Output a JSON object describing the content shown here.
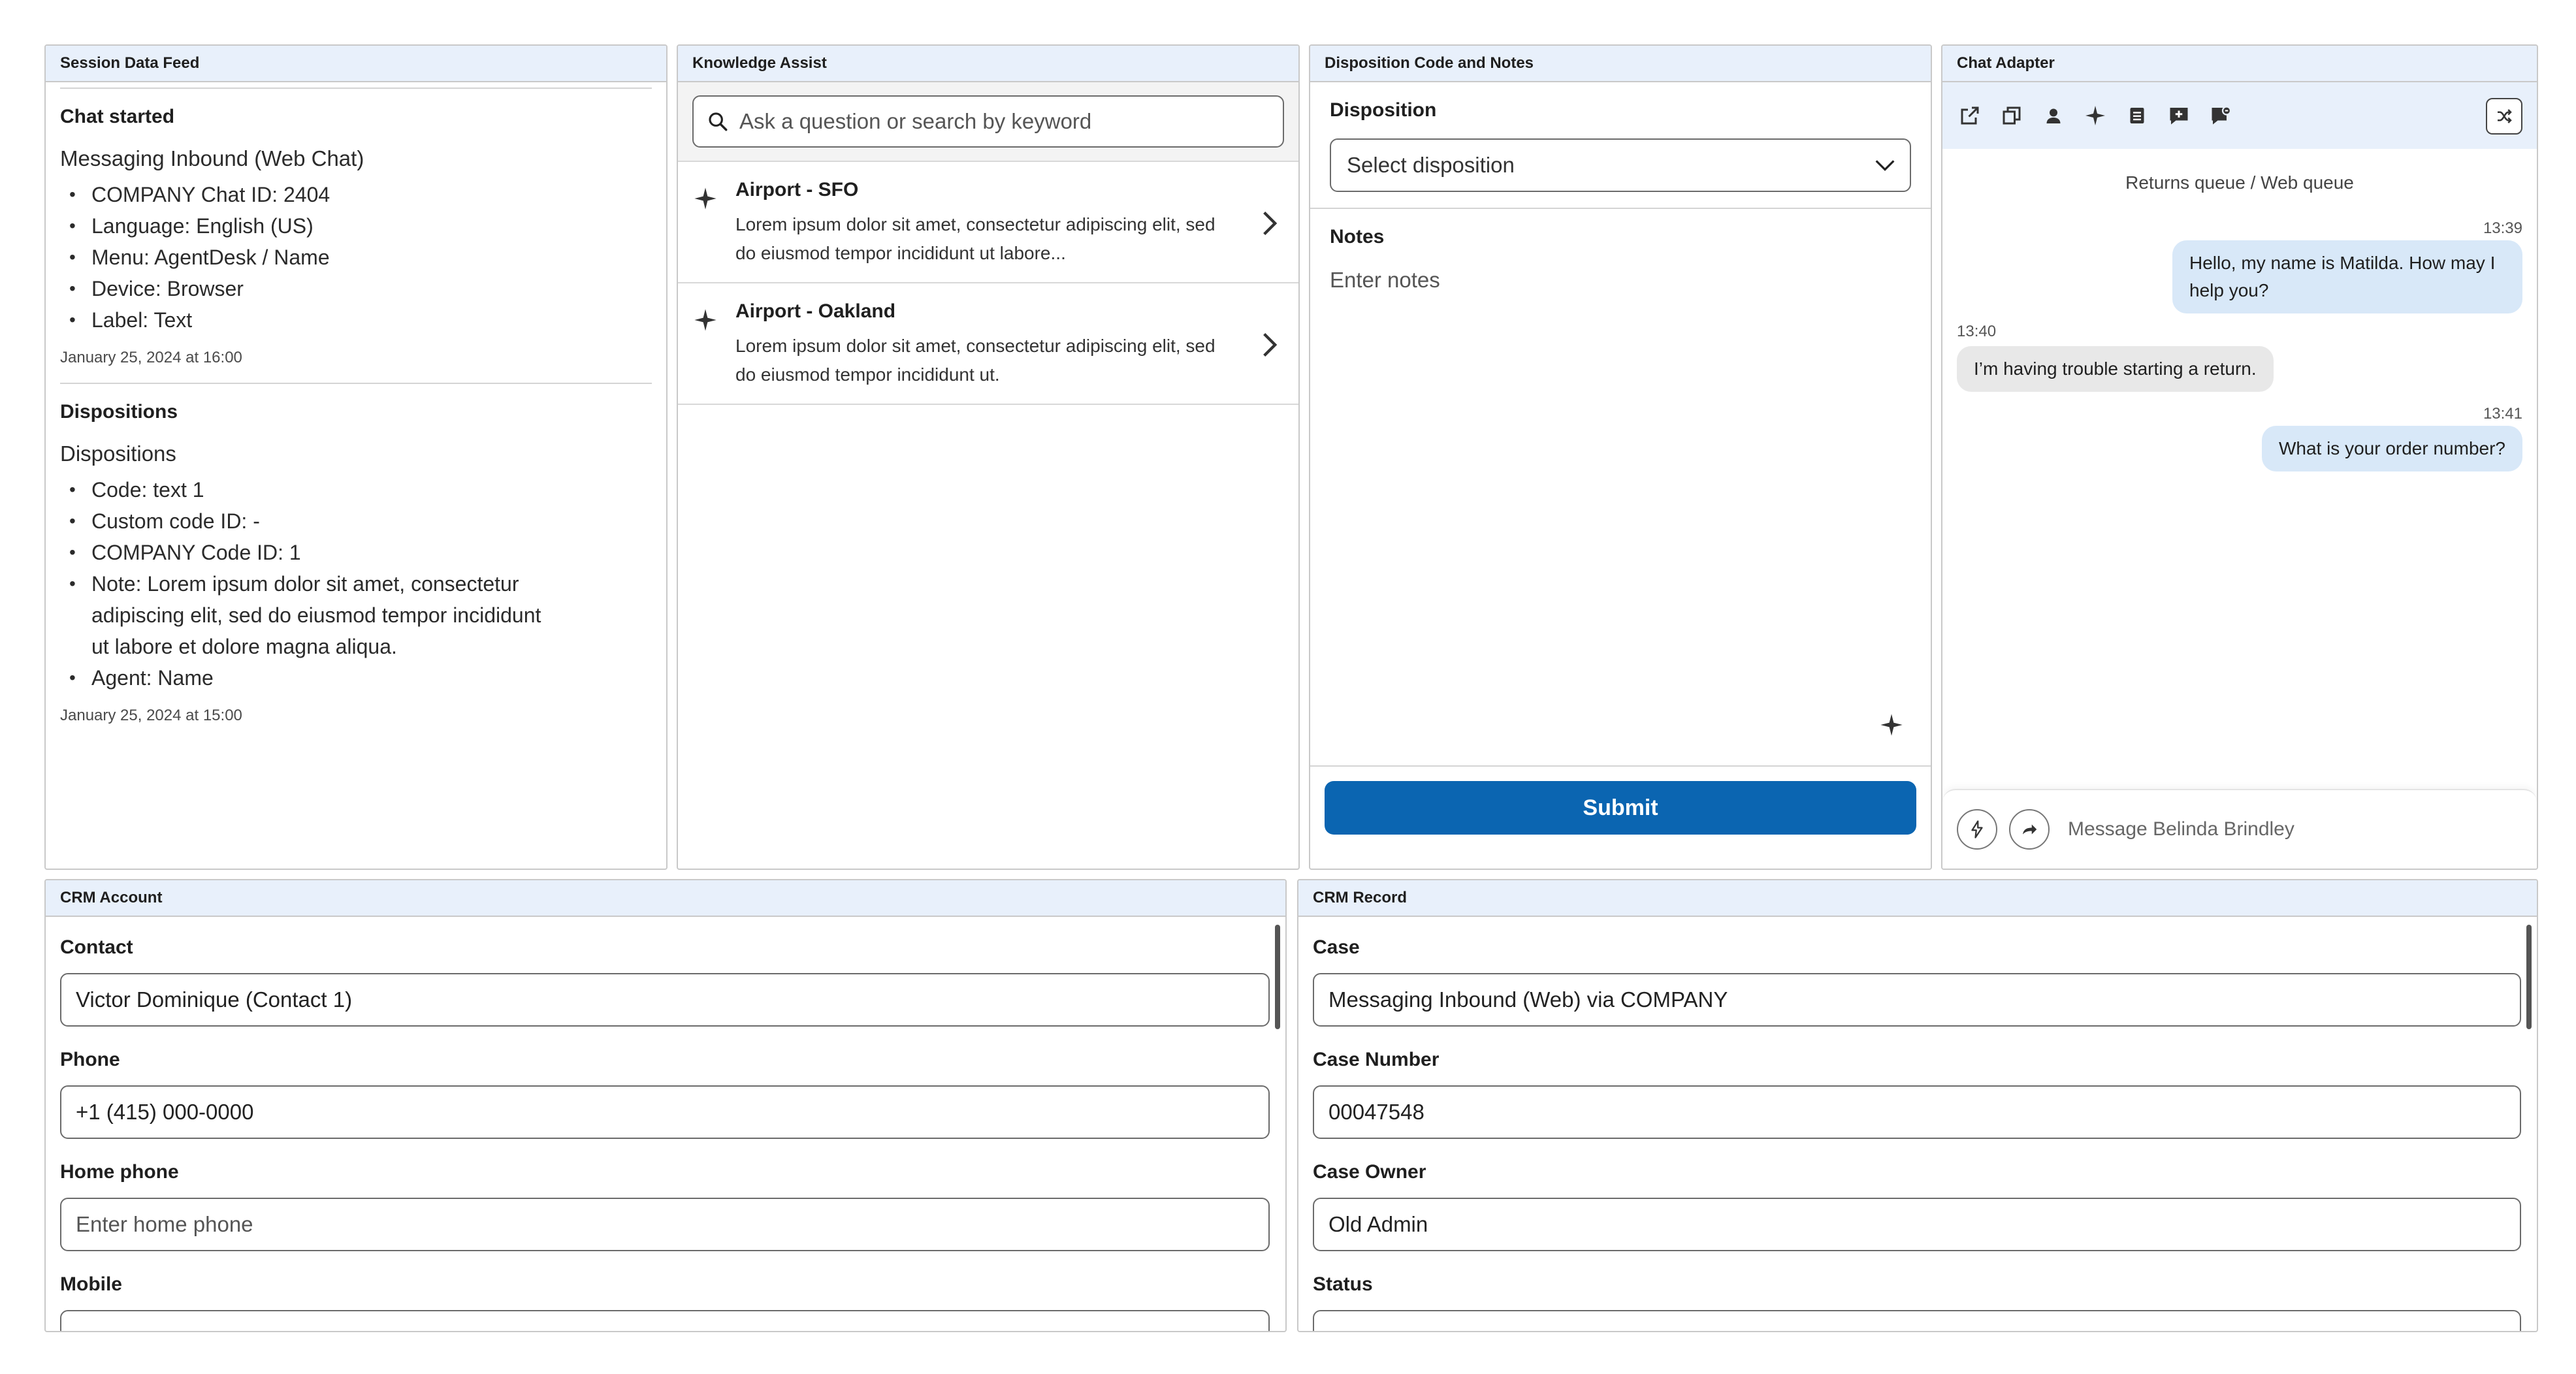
{
  "session_feed": {
    "title": "Session Data Feed",
    "chat_started": {
      "heading": "Chat started",
      "subtitle": "Messaging Inbound (Web Chat)",
      "items": [
        "COMPANY Chat ID: 2404",
        "Language: English (US)",
        "Menu: AgentDesk / Name",
        "Device: Browser",
        "Label: Text"
      ],
      "timestamp": "January 25, 2024 at 16:00"
    },
    "dispositions": {
      "heading": "Dispositions",
      "subtitle": "Dispositions",
      "items": [
        "Code: text 1",
        "Custom code ID: -",
        "COMPANY Code ID: 1",
        "Note: Lorem ipsum dolor sit amet, consectetur adipiscing elit, sed do eiusmod tempor incididunt ut labore et dolore magna aliqua.",
        "Agent: Name"
      ],
      "timestamp": "January 25, 2024 at 15:00"
    }
  },
  "knowledge": {
    "title": "Knowledge Assist",
    "search_placeholder": "Ask a question or search by keyword",
    "results": [
      {
        "title": "Airport - SFO",
        "body": "Lorem ipsum dolor sit amet, consectetur adipiscing elit, sed do eiusmod tempor incididunt ut labore..."
      },
      {
        "title": "Airport - Oakland",
        "body": "Lorem ipsum dolor sit amet, consectetur adipiscing elit, sed do eiusmod tempor incididunt ut."
      }
    ]
  },
  "disposition": {
    "title": "Disposition Code and Notes",
    "disposition_label": "Disposition",
    "select_value": "Select disposition",
    "notes_label": "Notes",
    "notes_placeholder": "Enter notes",
    "submit_label": "Submit"
  },
  "chat": {
    "title": "Chat Adapter",
    "toolbar_icons": [
      "external-link-icon",
      "copy-icon",
      "person-icon",
      "sparkle-icon",
      "list-icon",
      "add-comment-icon",
      "flag-comment-icon",
      "transfer-icon"
    ],
    "queue": "Returns queue / Web queue",
    "messages": [
      {
        "time": "13:39",
        "direction": "out",
        "text": "Hello, my name is Matilda. How may I help you?"
      },
      {
        "time": "13:40",
        "direction": "in",
        "text": "I’m having trouble starting a return."
      },
      {
        "time": "13:41",
        "direction": "out",
        "text": "What is your order number?"
      }
    ],
    "compose_placeholder": "Message Belinda Brindley",
    "accent": "#d8e8f8"
  },
  "crm_account": {
    "title": "CRM Account",
    "fields": [
      {
        "label": "Contact",
        "value": "Victor Dominique (Contact 1)",
        "placeholder": ""
      },
      {
        "label": "Phone",
        "value": "+1 (415) 000-0000",
        "placeholder": ""
      },
      {
        "label": "Home phone",
        "value": "",
        "placeholder": "Enter home phone"
      },
      {
        "label": "Mobile",
        "value": "",
        "placeholder": ""
      }
    ]
  },
  "crm_record": {
    "title": "CRM Record",
    "fields": [
      {
        "label": "Case",
        "value": "Messaging Inbound (Web) via COMPANY",
        "placeholder": ""
      },
      {
        "label": "Case Number",
        "value": "00047548",
        "placeholder": ""
      },
      {
        "label": "Case Owner",
        "value": "Old Admin",
        "placeholder": ""
      },
      {
        "label": "Status",
        "value": "",
        "placeholder": ""
      }
    ]
  },
  "colors": {
    "header_bg": "#e8f0fb",
    "primary_button": "#0b65b1",
    "outgoing_bubble": "#d8e8f8",
    "incoming_bubble": "#e8e8e8"
  }
}
